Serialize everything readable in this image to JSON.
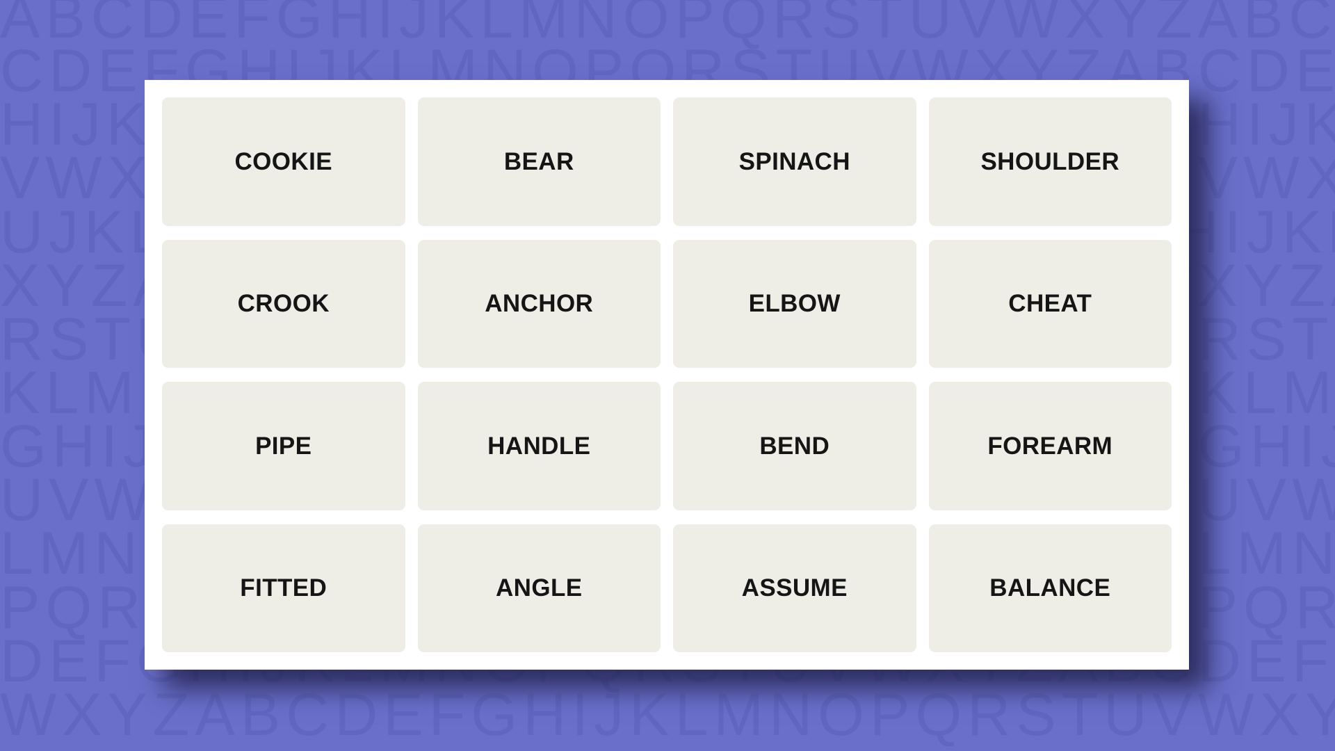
{
  "background": {
    "color": "#6a6fc9",
    "letter_color": "#6167c0",
    "pattern_rows": [
      "ABCDEFGHIJKLMNOPQRSTUVWXYZABCDEFGHIJKLMNOPQRSTUVWXYZ",
      "CDEFGHIJKLMNOPQRSTUVWXYZABCDEFGHIJKLMNOPQRSTUVWXYZAB",
      "HIJKLMNOPQRSTUVWXYZABCDEFGHIJKLMNOPQRSTUVWXYZABCDEFG",
      "VWXYZABCDEFGHIJKLMNOPQRSTUVWXYZABCDEFGHIJKLMNOPQRSTU",
      "UJKLMNOPQRSTUVWXYZABCDEFGHIJKLMNOPQRSTUVWXYZABCDEFGH",
      "XYZABCDEFGHIJKLMNOPQRSTUVWXYZABCDEFGHIJKLMNOPQRSTUVW",
      "RSTUVWXYZABCDEFGHIJKLMNOPQRSTUVWXYZABCDEFGHIJKLMNOPQ",
      "KLMNOPQRSTUVWXYZABCDEFGHIJKLMNOPQRSTUVWXYZABCDEFGHIJ",
      "GHIJKLMNOPQRSTUVWXYZABCDEFGHIJKLMNOPQRSTUVWXYZABCDEF",
      "UVWXYZABCDEFGHIJKLMNOPQRSTUVWXYZABCDEFGHIJKLMNOPQRST",
      "LMNOPQRSTUVWXYZABCDEFGHIJKLMNOPQRSTUVWXYZABCDEFGHIJK",
      "PQRSTUVWXYZABCDEFGHIJKLMNOPQRSTUVWXYZABCDEFGHIJKLMNO",
      "DEFGHIJKLMNOPQRSTUVWXYZABCDEFGHIJKLMNOPQRSTUVWXYZABC",
      "WXYZABCDEFGHIJKLMNOPQRSTUVWXYZABCDEFGHIJKLMNOPQRSTUV"
    ]
  },
  "board": {
    "card_color": "#ffffff",
    "tile_color": "#efeee6",
    "tile_text_color": "#151515",
    "rows": 4,
    "columns": 4,
    "tiles": [
      {
        "label": "COOKIE",
        "row": 1,
        "col": 1
      },
      {
        "label": "BEAR",
        "row": 1,
        "col": 2
      },
      {
        "label": "SPINACH",
        "row": 1,
        "col": 3
      },
      {
        "label": "SHOULDER",
        "row": 1,
        "col": 4
      },
      {
        "label": "CROOK",
        "row": 2,
        "col": 1
      },
      {
        "label": "ANCHOR",
        "row": 2,
        "col": 2
      },
      {
        "label": "ELBOW",
        "row": 2,
        "col": 3
      },
      {
        "label": "CHEAT",
        "row": 2,
        "col": 4
      },
      {
        "label": "PIPE",
        "row": 3,
        "col": 1
      },
      {
        "label": "HANDLE",
        "row": 3,
        "col": 2
      },
      {
        "label": "BEND",
        "row": 3,
        "col": 3
      },
      {
        "label": "FOREARM",
        "row": 3,
        "col": 4
      },
      {
        "label": "FITTED",
        "row": 4,
        "col": 1
      },
      {
        "label": "ANGLE",
        "row": 4,
        "col": 2
      },
      {
        "label": "ASSUME",
        "row": 4,
        "col": 3
      },
      {
        "label": "BALANCE",
        "row": 4,
        "col": 4
      }
    ]
  }
}
